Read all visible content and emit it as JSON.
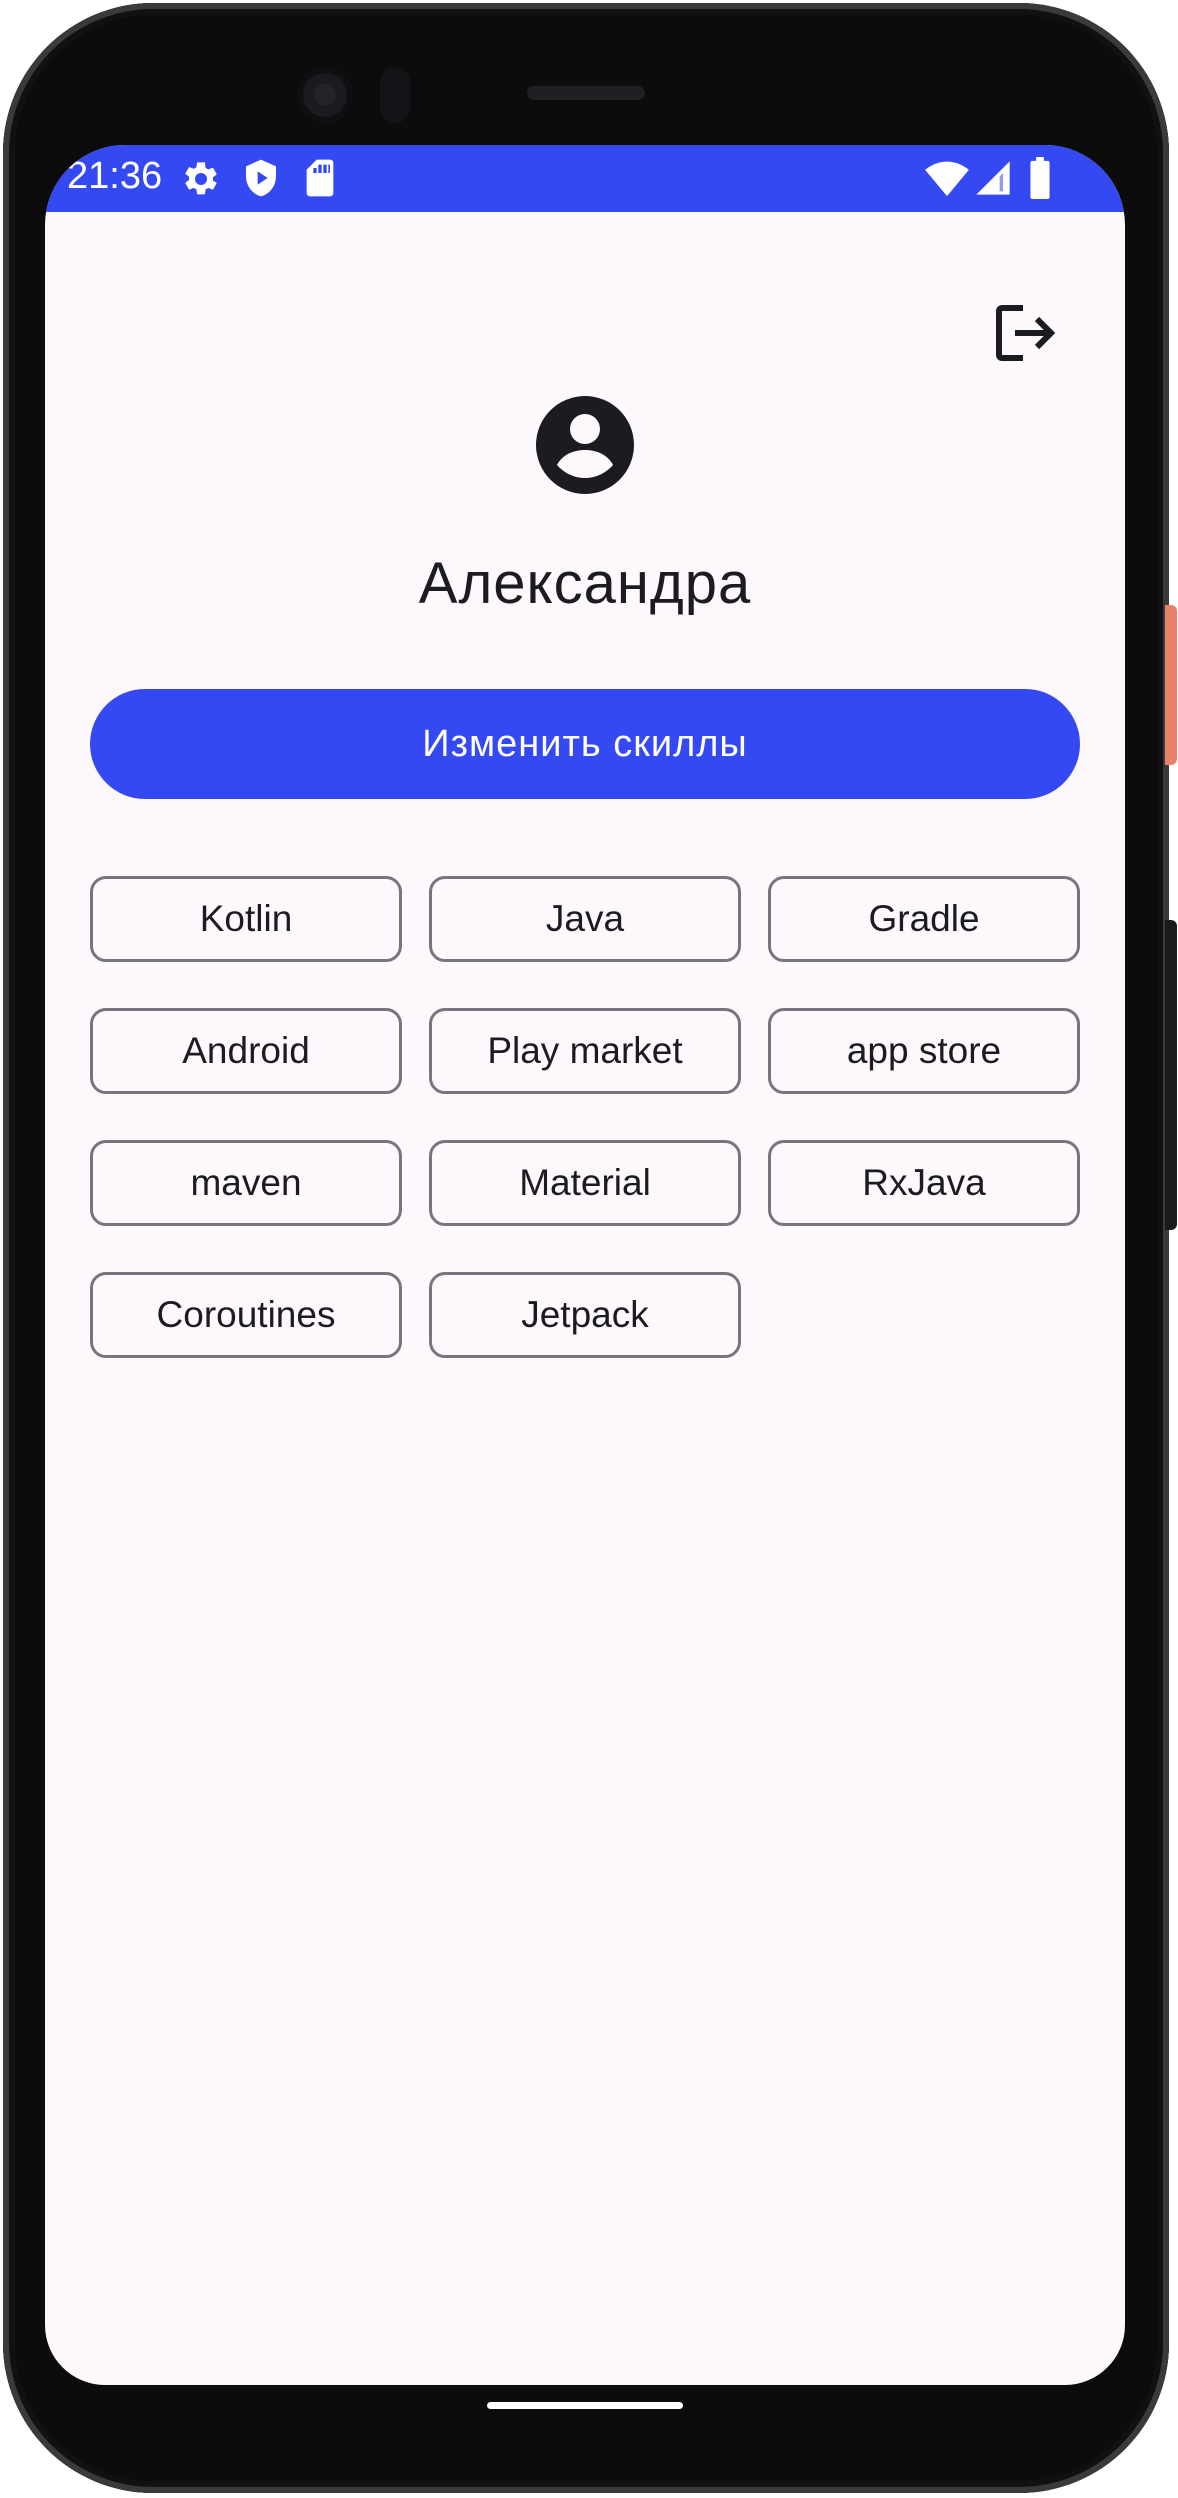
{
  "status_bar": {
    "time": "21:36",
    "background": "#3549f3",
    "left_icons": [
      "gear-icon",
      "shield-play-icon",
      "sd-card-icon"
    ],
    "right_icons": [
      "wifi-icon",
      "cell-signal-icon",
      "battery-icon"
    ]
  },
  "header": {
    "logout_icon": "logout-icon"
  },
  "profile": {
    "avatar_icon": "account-circle-icon",
    "name": "Александра"
  },
  "actions": {
    "edit_skills_label": "Изменить скиллы"
  },
  "skills": [
    "Kotlin",
    "Java",
    "Gradle",
    "Android",
    "Play market",
    "app store",
    "maven",
    "Material",
    "RxJava",
    "Coroutines",
    "Jetpack"
  ],
  "colors": {
    "accent": "#3549f3",
    "background": "#fdf8fc",
    "chip_border": "#79747e",
    "text": "#1c1b1f"
  }
}
